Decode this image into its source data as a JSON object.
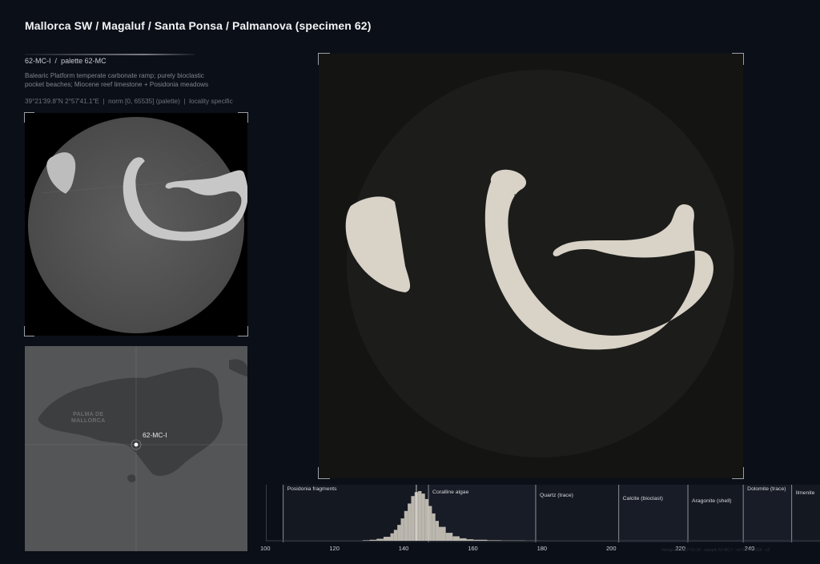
{
  "page": {
    "title": "Mallorca SW / Magaluf / Santa Ponsa / Palmanova (specimen 62)",
    "specimen_id": "62-MC-I",
    "palette": "palette 62-MC",
    "separator": "/",
    "description": "Balearic Platform temperate carbonate ramp; purely bioclastic pocket beaches; Miocene reef limestone + Posidonia meadows",
    "coordinates": "39°21'39.8\"N 2°57'41.1\"E",
    "norm": "norm [0, 65535] (palette)",
    "locality": "locality specific",
    "meta_sep": "|"
  },
  "map": {
    "city_label_line1": "PALMA DE",
    "city_label_line2": "MALLORCA",
    "pin_label": "62-MC-I"
  },
  "histogram": {
    "bands": [
      {
        "label": "Posidonia fragments",
        "start": 105,
        "end": 147
      },
      {
        "label": "Coralline algae",
        "start": 147,
        "end": 178
      },
      {
        "label": "Quartz (trace)",
        "start": 178,
        "end": 202
      },
      {
        "label": "Calcite (bioclast)",
        "start": 202,
        "end": 222
      },
      {
        "label": "Aragonite (shell)",
        "start": 222,
        "end": 238
      },
      {
        "label": "Dolomite (trace)",
        "start": 238,
        "end": 252
      },
      {
        "label": "Ilmenite",
        "start": 252,
        "end": 262
      }
    ],
    "ticks": [
      "100",
      "120",
      "140",
      "160",
      "180",
      "200",
      "220",
      "240"
    ],
    "footnote": "histogram 2007-03-26 · sample 62-MC-I · ref 62-MC-004 · v2"
  },
  "chart_data": {
    "type": "bar",
    "title": "",
    "xlabel": "",
    "ylabel": "",
    "xlim": [
      100,
      259
    ],
    "peak": 143.5,
    "x": [
      128,
      130,
      132,
      134,
      136,
      137,
      138,
      139,
      140,
      141,
      142,
      143,
      144,
      145,
      146,
      147,
      148,
      149,
      150,
      152,
      154,
      156,
      158,
      160,
      164,
      168,
      175
    ],
    "values": [
      0.01,
      0.02,
      0.04,
      0.08,
      0.15,
      0.22,
      0.32,
      0.45,
      0.6,
      0.75,
      0.9,
      0.98,
      1.0,
      0.95,
      0.84,
      0.7,
      0.55,
      0.4,
      0.28,
      0.16,
      0.09,
      0.05,
      0.03,
      0.02,
      0.01,
      0.005,
      0.002
    ]
  },
  "colors": {
    "background": "#0b0f17",
    "specimen_fill": "#d8d2c7",
    "band_divider": "#8a8e95"
  }
}
